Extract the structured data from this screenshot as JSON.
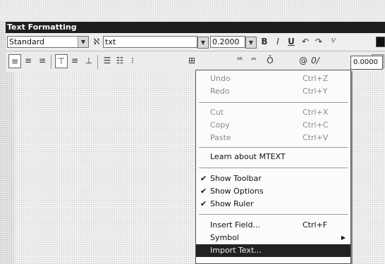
{
  "window": {
    "title": "Text Formatting"
  },
  "toolbar": {
    "style_value": "Standard",
    "font_value": "txt",
    "height_value": "0.2000",
    "bold": "B",
    "italic": "I",
    "underline": "U",
    "right_field_value": "0.0000"
  },
  "context_menu": {
    "items": [
      {
        "label": "Undo",
        "shortcut": "Ctrl+Z",
        "disabled": true
      },
      {
        "label": "Redo",
        "shortcut": "Ctrl+Y",
        "disabled": true
      },
      {
        "label": "Cut",
        "shortcut": "Ctrl+X",
        "disabled": true
      },
      {
        "label": "Copy",
        "shortcut": "Ctrl+C",
        "disabled": true
      },
      {
        "label": "Paste",
        "shortcut": "Ctrl+V",
        "disabled": true
      },
      {
        "label": "Learn about MTEXT",
        "shortcut": ""
      },
      {
        "label": "Show Toolbar",
        "shortcut": "",
        "checked": true
      },
      {
        "label": "Show Options",
        "shortcut": "",
        "checked": true
      },
      {
        "label": "Show Ruler",
        "shortcut": "",
        "checked": true
      },
      {
        "label": "Insert Field...",
        "shortcut": "Ctrl+F"
      },
      {
        "label": "Symbol",
        "shortcut": "",
        "submenu": true
      },
      {
        "label": "Import Text...",
        "shortcut": "",
        "highlighted": true
      }
    ]
  }
}
